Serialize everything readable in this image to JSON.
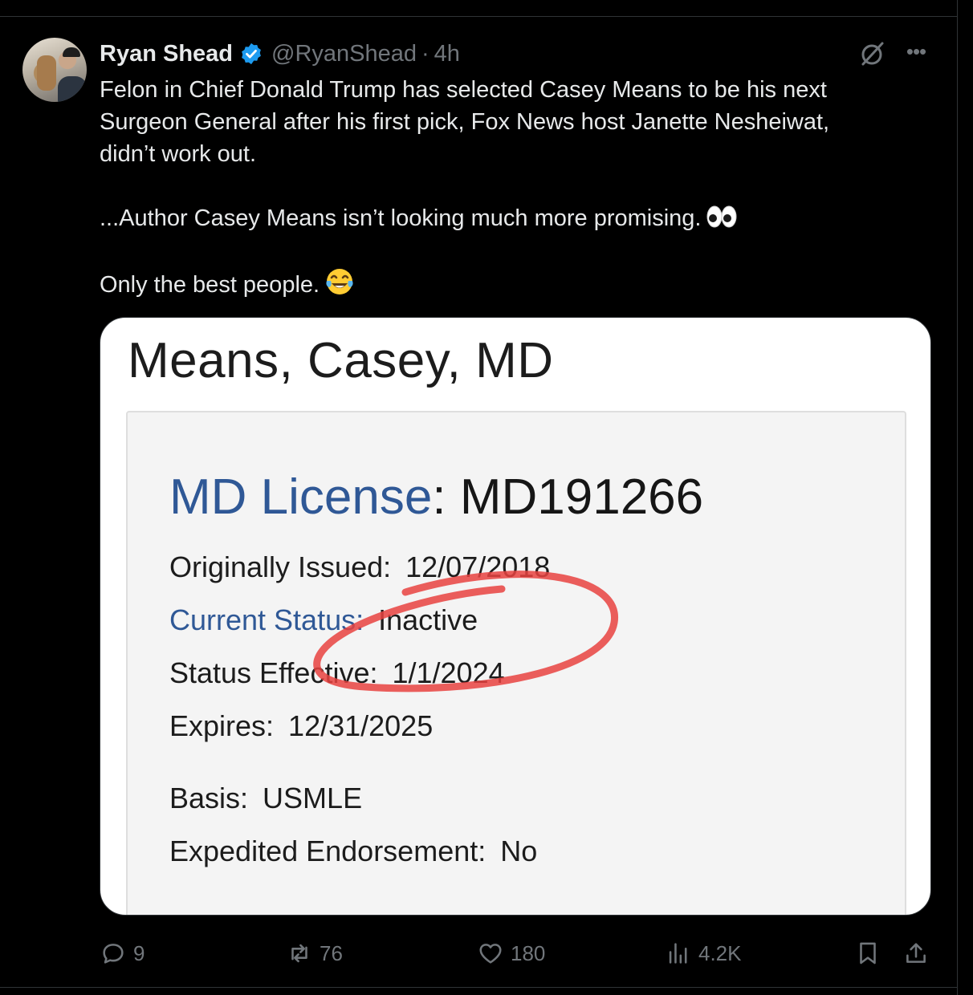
{
  "tweet": {
    "author_name": "Ryan Shead",
    "handle": "@RyanShead",
    "separator": "·",
    "time": "4h",
    "text_lines": [
      "Felon in Chief Donald Trump has selected Casey Means to be his next",
      "Surgeon General after his first pick, Fox News host Janette Nesheiwat,",
      "didn’t work out.",
      "...Author Casey Means isn’t looking much more promising.",
      "Only the best people."
    ],
    "emojis": [
      "eyes-emoji",
      "tears-of-joy-emoji"
    ]
  },
  "media": {
    "title": "Means, Casey, MD",
    "license_label": "MD License",
    "license_colon": ":",
    "license_number": "MD191266",
    "fields": [
      {
        "label": "Originally Issued:",
        "value": "12/07/2018"
      },
      {
        "label": "Current Status:",
        "value": "Inactive"
      },
      {
        "label": "Status Effective:",
        "value": "1/1/2024"
      },
      {
        "label": "Expires:",
        "value": "12/31/2025"
      },
      {
        "label": "Basis:",
        "value": "USMLE"
      },
      {
        "label": "Expedited Endorsement:",
        "value": "No"
      }
    ],
    "annotation_color": "#e8423f"
  },
  "actions": {
    "replies": "9",
    "reposts": "76",
    "likes": "180",
    "views": "4.2K"
  },
  "colors": {
    "verified": "#1d9bf0",
    "muted": "#71767b",
    "license_blue": "#2f5896"
  }
}
